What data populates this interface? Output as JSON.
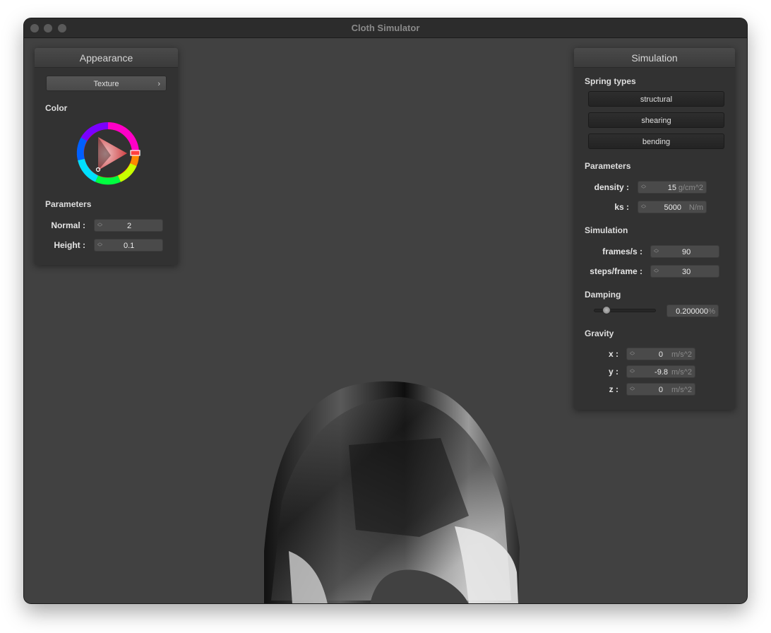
{
  "window": {
    "title": "Cloth Simulator"
  },
  "appearance": {
    "title": "Appearance",
    "texture_button": "Texture",
    "texture_chevron": "›",
    "color_label": "Color",
    "selected_color": "#c8272a",
    "parameters_label": "Parameters",
    "normal": {
      "label": "Normal :",
      "value": "2"
    },
    "height": {
      "label": "Height :",
      "value": "0.1"
    }
  },
  "simulation": {
    "title": "Simulation",
    "spring_types_label": "Spring types",
    "spring_buttons": [
      "structural",
      "shearing",
      "bending"
    ],
    "parameters_label": "Parameters",
    "density": {
      "label": "density :",
      "value": "15",
      "unit": "g/cm^2"
    },
    "ks": {
      "label": "ks :",
      "value": "5000",
      "unit": "N/m"
    },
    "simulation_label": "Simulation",
    "fps": {
      "label": "frames/s :",
      "value": "90"
    },
    "steps": {
      "label": "steps/frame :",
      "value": "30"
    },
    "damping_label": "Damping",
    "damping": {
      "value": "0.200000",
      "unit": "%",
      "slider_fraction": 0.2
    },
    "gravity_label": "Gravity",
    "gravity_x": {
      "label": "x :",
      "value": "0",
      "unit": "m/s^2"
    },
    "gravity_y": {
      "label": "y :",
      "value": "-9.8",
      "unit": "m/s^2"
    },
    "gravity_z": {
      "label": "z :",
      "value": "0",
      "unit": "m/s^2"
    }
  }
}
